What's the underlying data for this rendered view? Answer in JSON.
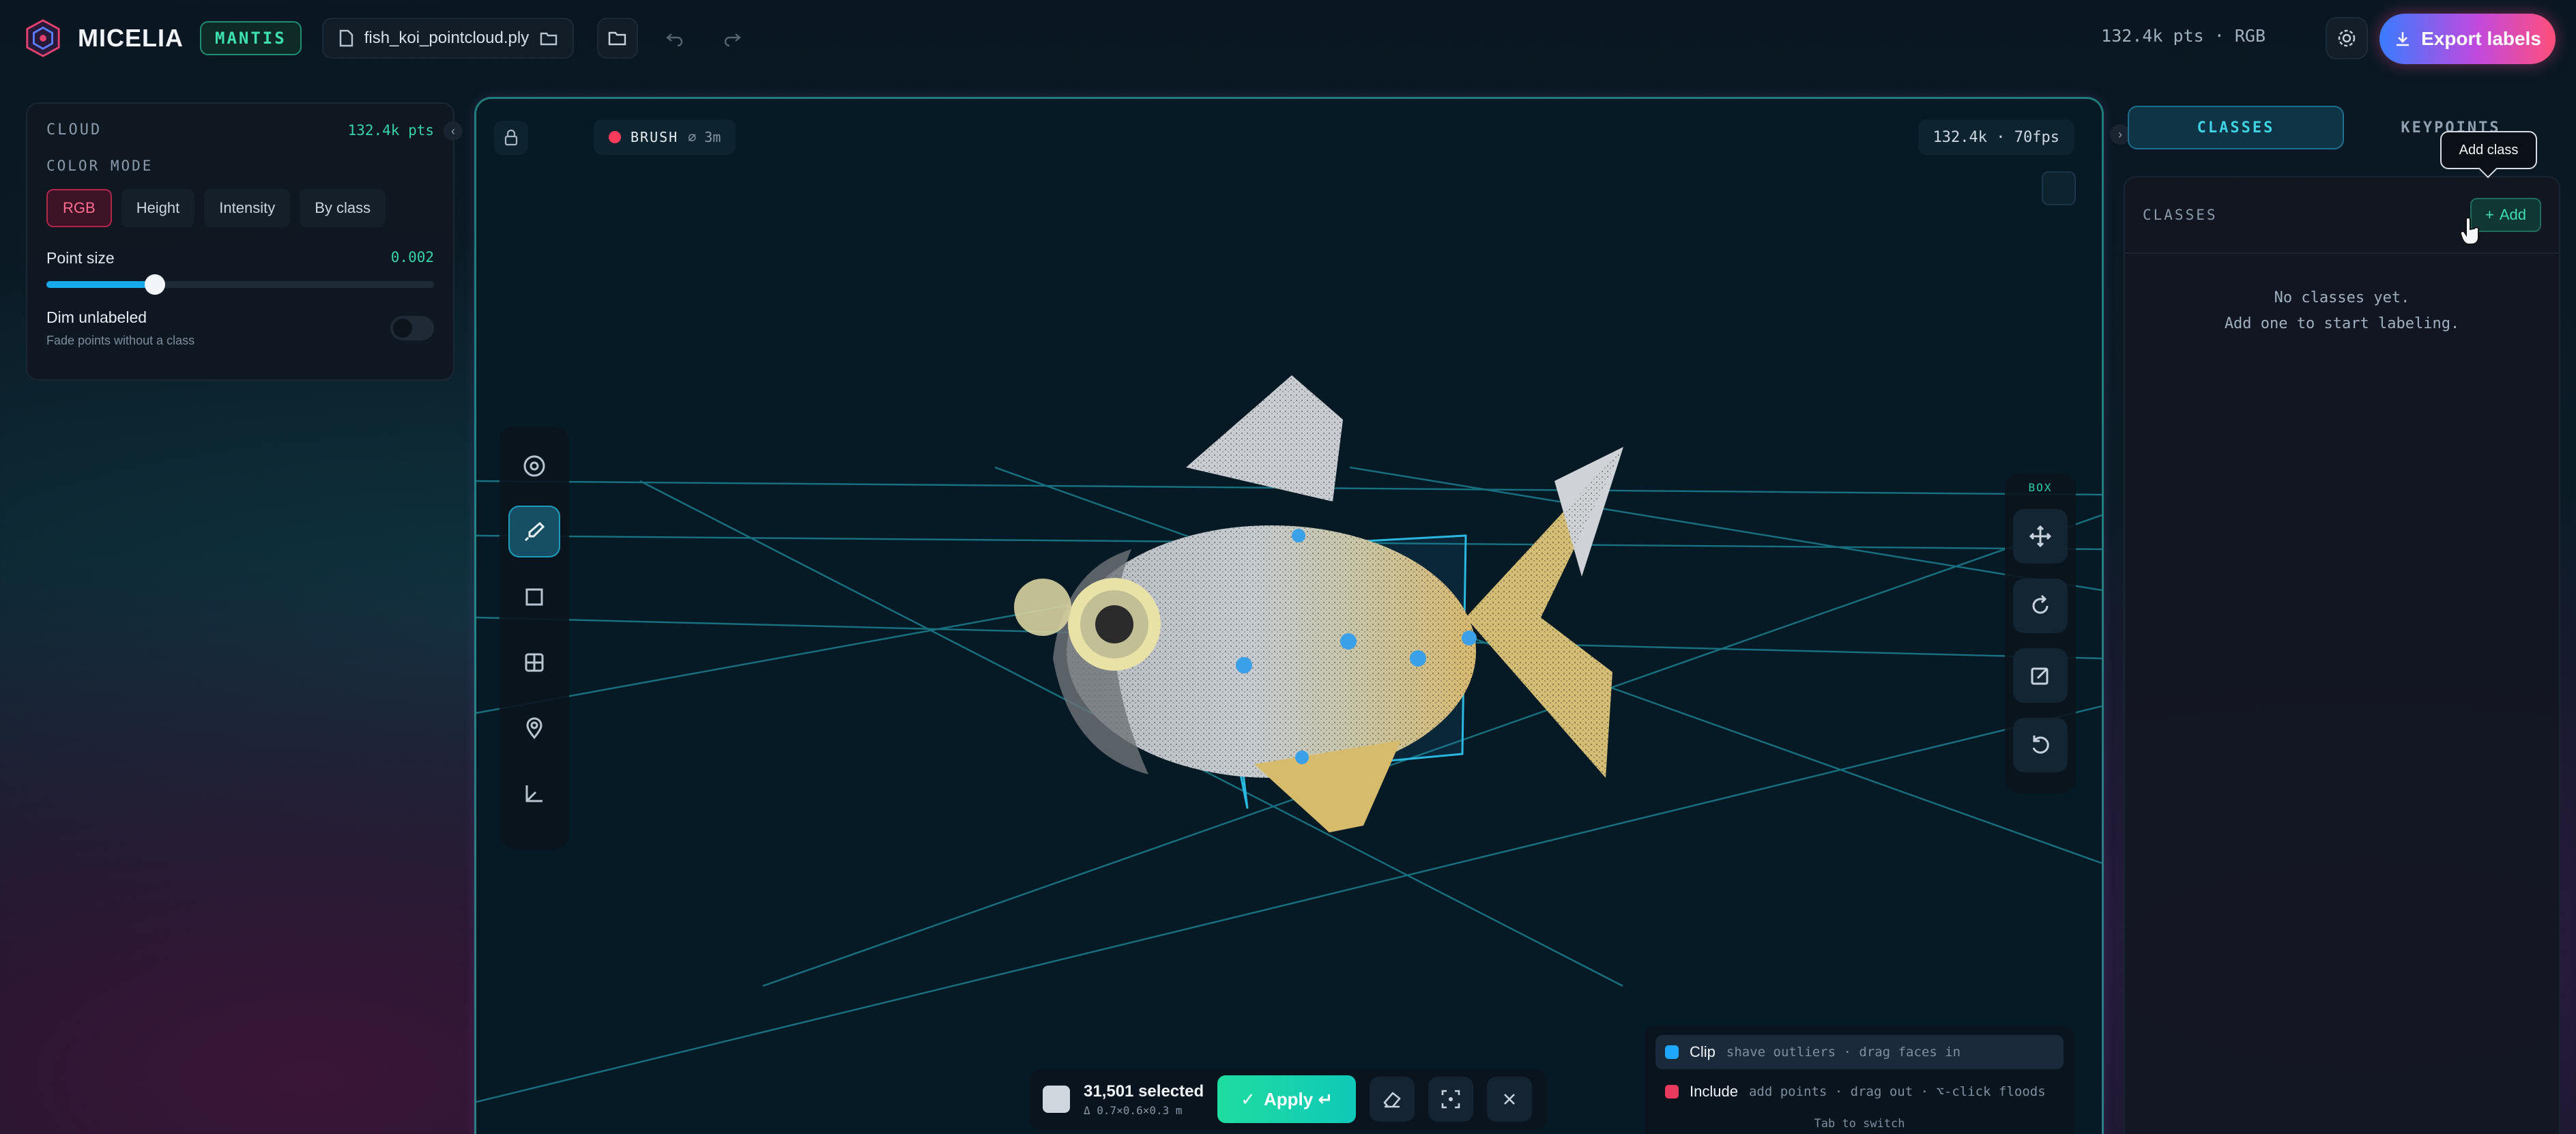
{
  "app": {
    "brand": "MICELIA",
    "mode_badge": "MANTIS"
  },
  "toolbar": {
    "file_name": "fish_koi_pointcloud.ply",
    "stats": "132.4k pts · RGB",
    "export_label": "Export labels"
  },
  "cloud_panel": {
    "title": "CLOUD",
    "points": "132.4k pts",
    "color_mode_label": "COLOR MODE",
    "color_modes": [
      "RGB",
      "Height",
      "Intensity",
      "By class"
    ],
    "active_color_mode": "RGB",
    "point_size_label": "Point size",
    "point_size_value": "0.002",
    "point_size_fraction": 0.28,
    "dim_label": "Dim unlabeled",
    "dim_sub": "Fade points without a class",
    "dim_enabled": false
  },
  "viewport": {
    "brush_label": "BRUSH",
    "brush_size": "⌀ 3m",
    "fps_label": "132.4k · 70fps",
    "box_label": "BOX"
  },
  "tools": [
    {
      "name": "orbit-icon"
    },
    {
      "name": "brush-icon",
      "active": true
    },
    {
      "name": "box-select-icon"
    },
    {
      "name": "grid-icon"
    },
    {
      "name": "pin-icon"
    },
    {
      "name": "axes-icon"
    }
  ],
  "box_tools": [
    {
      "name": "move-icon"
    },
    {
      "name": "rotate-icon"
    },
    {
      "name": "edit-icon"
    },
    {
      "name": "reset-icon"
    }
  ],
  "selection": {
    "count": "31,501 selected",
    "dims": "Δ 0.7×0.6×0.3 m",
    "apply_label": "Apply ↵"
  },
  "clip_panel": {
    "rows": [
      {
        "name": "Clip",
        "desc": "shave outliers · drag faces in",
        "color": "#1ea7ff",
        "active": true
      },
      {
        "name": "Include",
        "desc": "add points · drag out · ⌥-click floods",
        "color": "#e83a5c",
        "active": false
      }
    ],
    "hint": "Tab to switch"
  },
  "right_panel": {
    "tabs": [
      "CLASSES",
      "KEYPOINTS"
    ],
    "active_tab": "CLASSES",
    "section_title": "CLASSES",
    "add_label": "Add",
    "empty_line1": "No classes yet.",
    "empty_line2": "Add one to start labeling.",
    "tooltip": "Add class"
  },
  "colors": {
    "accent_teal": "#2bd0a9",
    "accent_blue": "#17a9e8",
    "brush_red": "#ff3b5c",
    "export_gradient": [
      "#3a7bff",
      "#c04adf",
      "#ff4f7b"
    ]
  }
}
